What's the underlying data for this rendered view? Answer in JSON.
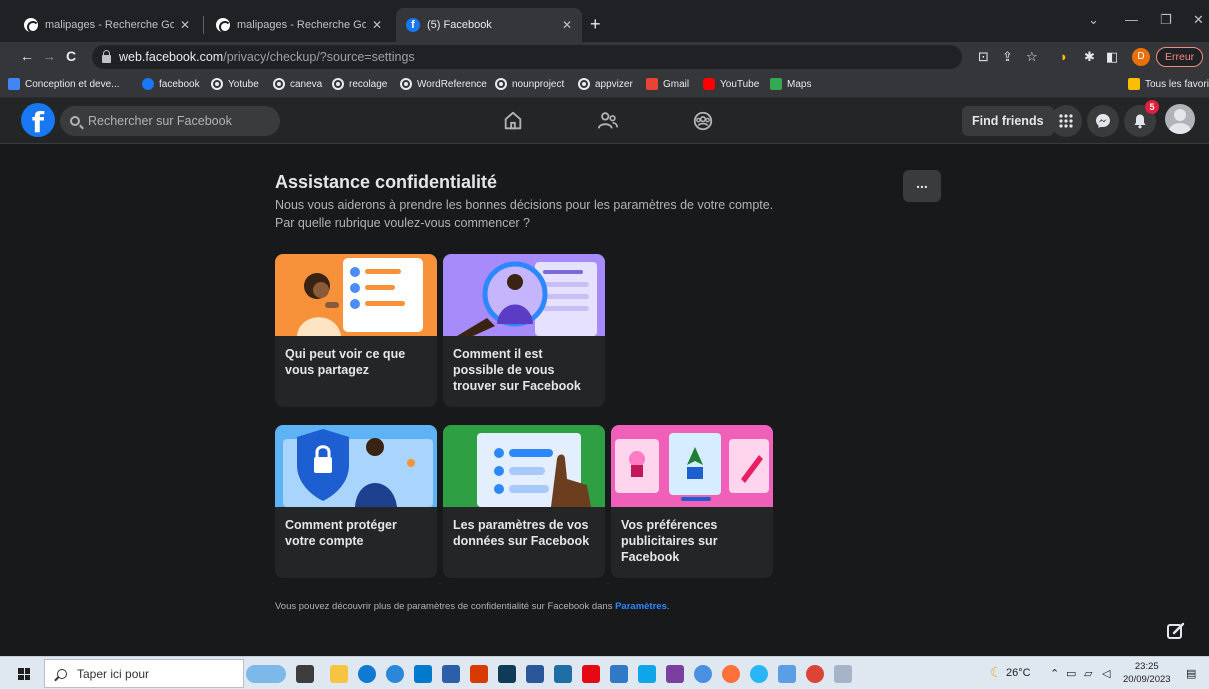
{
  "browser": {
    "tabs": [
      {
        "title": "malipages - Recherche Google",
        "favicon": "google-icon"
      },
      {
        "title": "malipages - Recherche Google",
        "favicon": "google-icon"
      },
      {
        "title": "(5) Facebook",
        "favicon": "facebook-icon"
      }
    ],
    "active_tab": 2,
    "url_host": "web.facebook.com",
    "url_path": "/privacy/checkup/?source=settings",
    "profile_initial": "D",
    "error_label": "Erreur",
    "bookmarks": [
      {
        "label": "Conception et deve...",
        "icon": "devtools-icon"
      },
      {
        "label": "facebook",
        "icon": "facebook-icon"
      },
      {
        "label": "Yotube",
        "icon": "globe-icon"
      },
      {
        "label": "caneva",
        "icon": "globe-icon"
      },
      {
        "label": "recolage",
        "icon": "globe-icon"
      },
      {
        "label": "WordReference",
        "icon": "globe-icon"
      },
      {
        "label": "nounproject",
        "icon": "globe-icon"
      },
      {
        "label": "appvizer",
        "icon": "globe-icon"
      },
      {
        "label": "Gmail",
        "icon": "gmail-icon"
      },
      {
        "label": "YouTube",
        "icon": "youtube-icon"
      },
      {
        "label": "Maps",
        "icon": "maps-icon"
      }
    ],
    "all_bookmarks_label": "Tous les favoris"
  },
  "fb": {
    "search_placeholder": "Rechercher sur Facebook",
    "find_friends": "Find friends",
    "notification_count": "5",
    "brand_color": "#1877f2"
  },
  "page": {
    "title": "Assistance confidentialité",
    "subtitle_line1": "Nous vous aiderons à prendre les bonnes décisions pour les paramètres de votre compte.",
    "subtitle_line2": "Par quelle rubrique voulez-vous commencer ?",
    "more_label": "...",
    "cards": [
      {
        "label": "Qui peut voir ce que vous partagez",
        "bg": "#f7923a"
      },
      {
        "label": "Comment il est possible de vous trouver sur Facebook",
        "bg": "#a78bfa"
      },
      {
        "label": "Comment protéger votre compte",
        "bg": "#5eb3f6"
      },
      {
        "label": "Les paramètres de vos données sur Facebook",
        "bg": "#2ea043"
      },
      {
        "label": "Vos préférences publicitaires sur Facebook",
        "bg": "#f05fb8"
      }
    ],
    "footnote_text": "Vous pouvez découvrir plus de paramètres de confidentialité sur Facebook dans ",
    "footnote_link": "Paramètres",
    "footnote_end": "."
  },
  "taskbar": {
    "search_placeholder": "Taper ici pour",
    "weather": "26°C",
    "time": "23:25",
    "date": "20/09/2023"
  }
}
